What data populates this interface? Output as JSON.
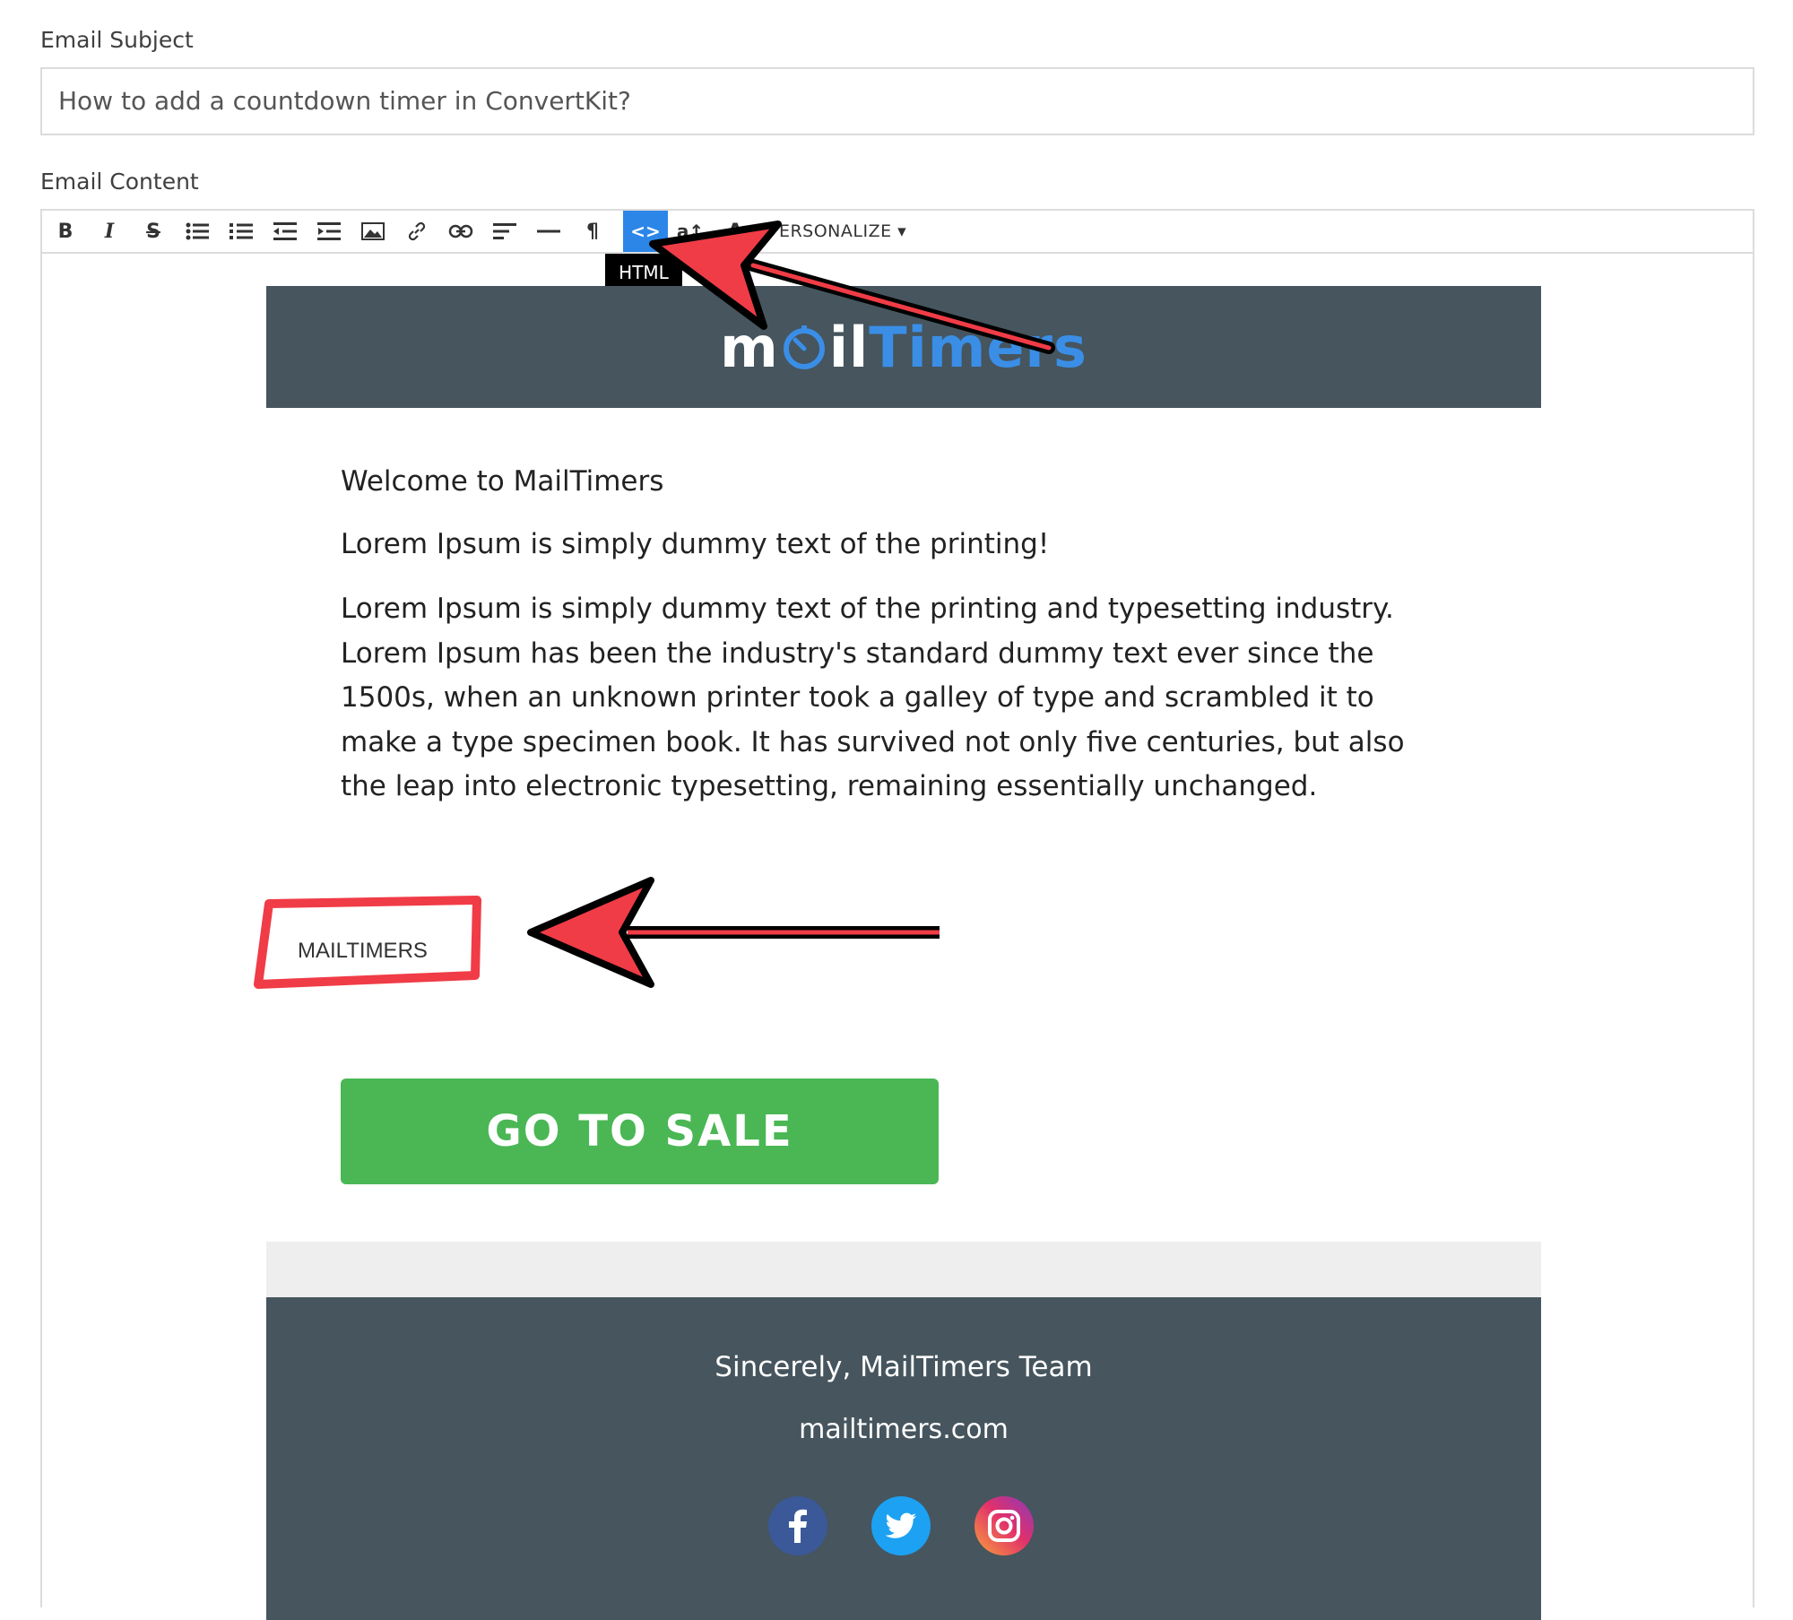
{
  "subject": {
    "label": "Email Subject",
    "value": "How to add a countdown timer in ConvertKit?"
  },
  "content": {
    "label": "Email Content"
  },
  "toolbar": {
    "buttons": [
      {
        "name": "bold",
        "glyph": "B"
      },
      {
        "name": "italic",
        "glyph": "I"
      },
      {
        "name": "strikethrough",
        "glyph": "S"
      },
      {
        "name": "bullet-list",
        "icon": "bullet-list-icon"
      },
      {
        "name": "numbered-list",
        "icon": "numbered-list-icon"
      },
      {
        "name": "outdent",
        "icon": "outdent-icon"
      },
      {
        "name": "indent",
        "icon": "indent-icon"
      },
      {
        "name": "image",
        "icon": "image-icon"
      },
      {
        "name": "link",
        "icon": "link-icon"
      },
      {
        "name": "unlink",
        "icon": "unlink-icon"
      },
      {
        "name": "align",
        "icon": "align-left-icon"
      },
      {
        "name": "horizontal-rule",
        "icon": "horizontal-rule-icon"
      },
      {
        "name": "paragraph",
        "glyph": "¶"
      },
      {
        "name": "html",
        "glyph": "<>"
      },
      {
        "name": "font-size",
        "glyph": "a↕"
      },
      {
        "name": "font-color",
        "glyph": "A"
      }
    ],
    "personalize_label": "PERSONALIZE",
    "html_tooltip": "HTML"
  },
  "email": {
    "logo": {
      "part1": "m",
      "part2": "il",
      "part3": "Timers"
    },
    "welcome": "Welcome to MailTimers",
    "tagline": "Lorem Ipsum is simply dummy text of the printing!",
    "paragraph": "Lorem Ipsum is simply dummy text of the printing and typesetting industry. Lorem Ipsum has been the industry's standard dummy text ever since the 1500s, when an unknown printer took a galley of type and scrambled it to make a type specimen book. It has survived not only five centuries, but also the leap into electronic typesetting, remaining essentially unchanged.",
    "timer_text": "MAILTIMERS",
    "cta": "GO TO SALE",
    "footer": {
      "signoff": "Sincerely, MailTimers Team",
      "website": "mailtimers.com",
      "social": [
        "facebook-icon",
        "twitter-icon",
        "instagram-icon"
      ]
    }
  },
  "colors": {
    "header_bg": "#46555e",
    "active_button": "#2c86e8",
    "cta_green": "#4ab754",
    "annotation_red": "#f03c46",
    "logo_blue": "#3a8ee6"
  }
}
